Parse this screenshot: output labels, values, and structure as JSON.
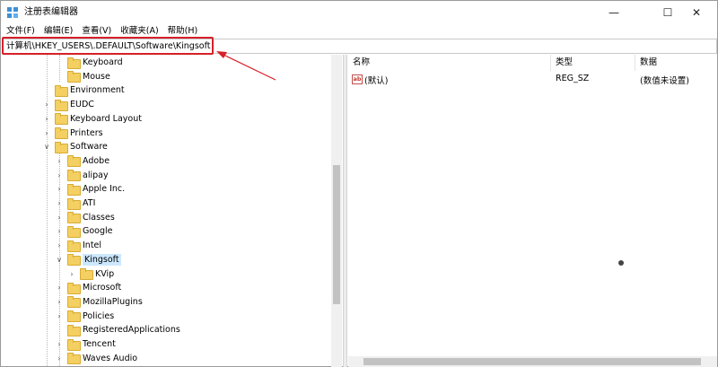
{
  "window": {
    "title": "注册表编辑器",
    "controls": {
      "minimize": "—",
      "maximize": "☐",
      "close": "✕"
    }
  },
  "menu": [
    "文件(F)",
    "编辑(E)",
    "查看(V)",
    "收藏夹(A)",
    "帮助(H)"
  ],
  "address": {
    "path": "计算机\\HKEY_USERS\\.DEFAULT\\Software\\Kingsoft"
  },
  "tree": [
    {
      "label": "Keyboard",
      "level": 2,
      "arrow": ""
    },
    {
      "label": "Mouse",
      "level": 2,
      "arrow": ""
    },
    {
      "label": "Environment",
      "level": 1,
      "arrow": ""
    },
    {
      "label": "EUDC",
      "level": 1,
      "arrow": ">"
    },
    {
      "label": "Keyboard Layout",
      "level": 1,
      "arrow": ">"
    },
    {
      "label": "Printers",
      "level": 1,
      "arrow": ">"
    },
    {
      "label": "Software",
      "level": 1,
      "arrow": "v"
    },
    {
      "label": "Adobe",
      "level": 2,
      "arrow": ">"
    },
    {
      "label": "alipay",
      "level": 2,
      "arrow": ">"
    },
    {
      "label": "Apple Inc.",
      "level": 2,
      "arrow": ">"
    },
    {
      "label": "ATI",
      "level": 2,
      "arrow": ">"
    },
    {
      "label": "Classes",
      "level": 2,
      "arrow": ">"
    },
    {
      "label": "Google",
      "level": 2,
      "arrow": ">"
    },
    {
      "label": "Intel",
      "level": 2,
      "arrow": ">"
    },
    {
      "label": "Kingsoft",
      "level": 2,
      "arrow": "v",
      "selected": true
    },
    {
      "label": "KVip",
      "level": 3,
      "arrow": ">"
    },
    {
      "label": "Microsoft",
      "level": 2,
      "arrow": ">"
    },
    {
      "label": "MozillaPlugins",
      "level": 2,
      "arrow": ">"
    },
    {
      "label": "Policies",
      "level": 2,
      "arrow": ">"
    },
    {
      "label": "RegisteredApplications",
      "level": 2,
      "arrow": ""
    },
    {
      "label": "Tencent",
      "level": 2,
      "arrow": ">"
    },
    {
      "label": "Waves Audio",
      "level": 2,
      "arrow": ">"
    }
  ],
  "values": {
    "columns": {
      "name": "名称",
      "type": "类型",
      "data": "数据"
    },
    "rows": [
      {
        "icon": "ab",
        "name": "(默认)",
        "type": "REG_SZ",
        "data": "(数值未设置)"
      }
    ]
  },
  "colors": {
    "highlight": "#d6202a",
    "folder": "#f4cf61",
    "selection": "#cce8ff"
  }
}
